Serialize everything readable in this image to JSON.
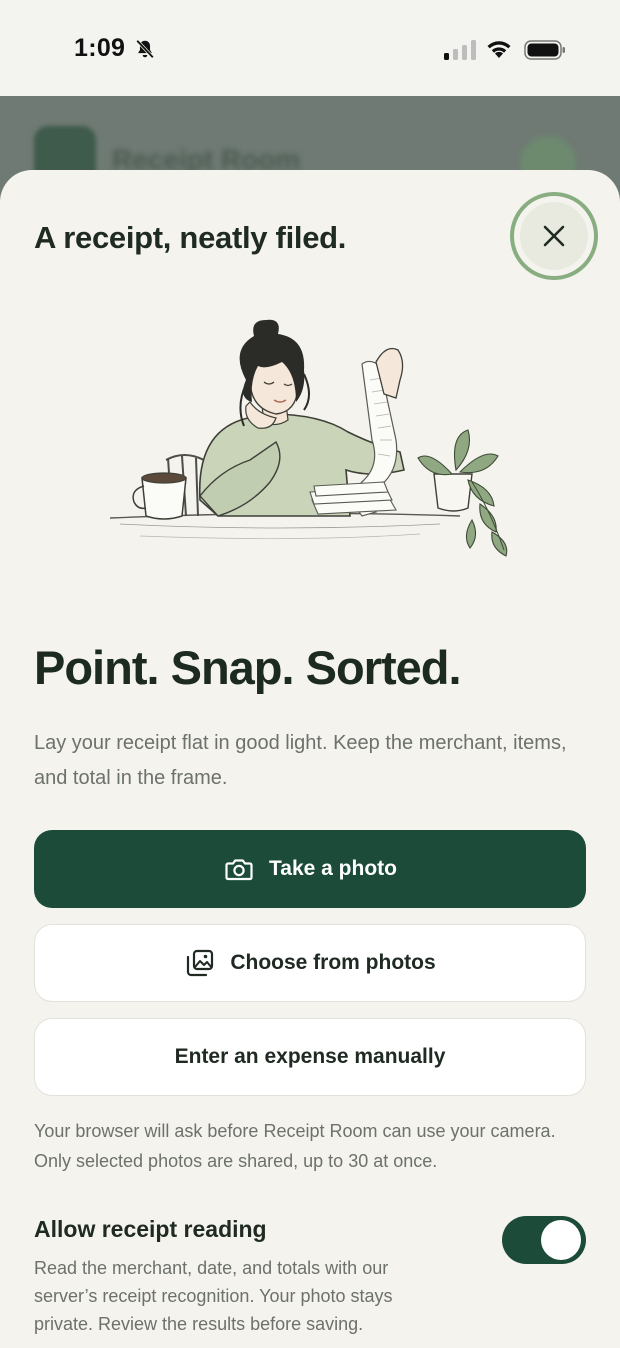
{
  "status_bar": {
    "time": "1:09",
    "icons": [
      "bell-slash-icon",
      "cellular-signal-icon",
      "wifi-icon",
      "battery-icon"
    ]
  },
  "background_app": {
    "title": "Receipt Room"
  },
  "sheet": {
    "title": "A receipt, neatly filed.",
    "close_icon": "close-icon",
    "illustration": "woman-reading-receipt-illustration",
    "headline": "Point. Snap. Sorted.",
    "description": "Lay your receipt flat in good light. Keep the merchant, items, and total in the frame.",
    "buttons": {
      "take_photo": {
        "label": "Take a photo",
        "icon": "camera-icon"
      },
      "choose_photos": {
        "label": "Choose from photos",
        "icon": "photo-library-icon"
      },
      "manual": {
        "label": "Enter an expense manually"
      }
    },
    "note": "Your browser will ask before Receipt Room can use your camera. Only selected photos are shared, up to 30 at once.",
    "receipt_reading": {
      "title": "Allow receipt reading",
      "enabled": true,
      "description": "Read the merchant, date, and totals with our server’s receipt recognition. Your photo stays private. Review the results before saving."
    }
  },
  "colors": {
    "primary": "#1c4b3a",
    "background": "#f4f3ee",
    "close_ring": "#88ad80",
    "muted_text": "#6d716c"
  }
}
